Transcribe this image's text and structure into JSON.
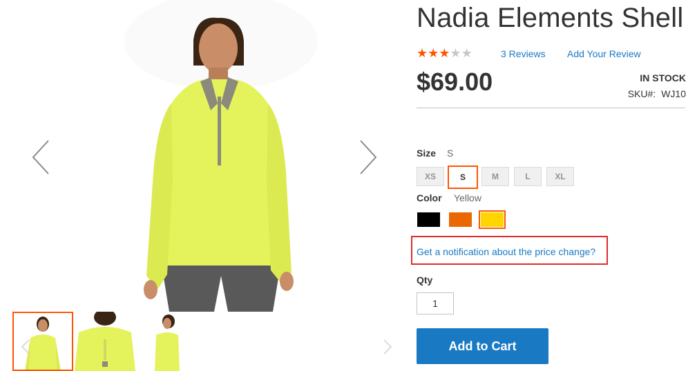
{
  "product": {
    "title": "Nadia Elements Shell",
    "rating": {
      "stars_filled": 3,
      "stars_total": 5
    },
    "reviews_link": "3 Reviews",
    "add_review_link": "Add Your Review",
    "price": "$69.00",
    "stock_status": "IN STOCK",
    "sku_label": "SKU#:",
    "sku_value": "WJ10"
  },
  "options": {
    "size": {
      "label": "Size",
      "selected": "S",
      "values": [
        "XS",
        "S",
        "M",
        "L",
        "XL"
      ]
    },
    "color": {
      "label": "Color",
      "selected": "Yellow",
      "swatches": [
        {
          "name": "Black",
          "hex": "#000000"
        },
        {
          "name": "Orange",
          "hex": "#eb6703"
        },
        {
          "name": "Yellow",
          "hex": "#ffd500"
        }
      ]
    }
  },
  "price_alert": {
    "link": "Get a notification about the price change?"
  },
  "qty": {
    "label": "Qty",
    "value": "1"
  },
  "cart": {
    "button": "Add to Cart"
  },
  "colors": {
    "accent": "#ff5501",
    "link": "#1979c3",
    "button": "#1979c3",
    "highlight_box": "#e02b27"
  }
}
